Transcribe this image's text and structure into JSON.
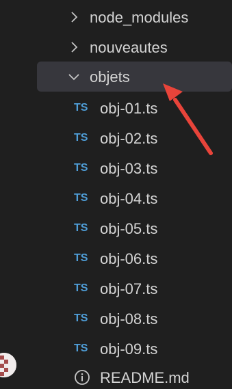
{
  "tree": {
    "folders": [
      {
        "label": "node_modules",
        "expanded": false
      },
      {
        "label": "nouveautes",
        "expanded": false
      },
      {
        "label": "objets",
        "expanded": true,
        "selected": true
      }
    ],
    "files": [
      {
        "badge": "TS",
        "label": "obj-01.ts"
      },
      {
        "badge": "TS",
        "label": "obj-02.ts"
      },
      {
        "badge": "TS",
        "label": "obj-03.ts"
      },
      {
        "badge": "TS",
        "label": "obj-04.ts"
      },
      {
        "badge": "TS",
        "label": "obj-05.ts"
      },
      {
        "badge": "TS",
        "label": "obj-06.ts"
      },
      {
        "badge": "TS",
        "label": "obj-07.ts"
      },
      {
        "badge": "TS",
        "label": "obj-08.ts"
      },
      {
        "badge": "TS",
        "label": "obj-09.ts"
      },
      {
        "badge": "info-icon",
        "label": "README.md"
      }
    ]
  },
  "colors": {
    "background": "#1f1f1f",
    "selected_row": "#37373d",
    "ts_badge": "#4f9ed8",
    "annotation_arrow": "#e8443a",
    "text": "#d4d4d4"
  }
}
